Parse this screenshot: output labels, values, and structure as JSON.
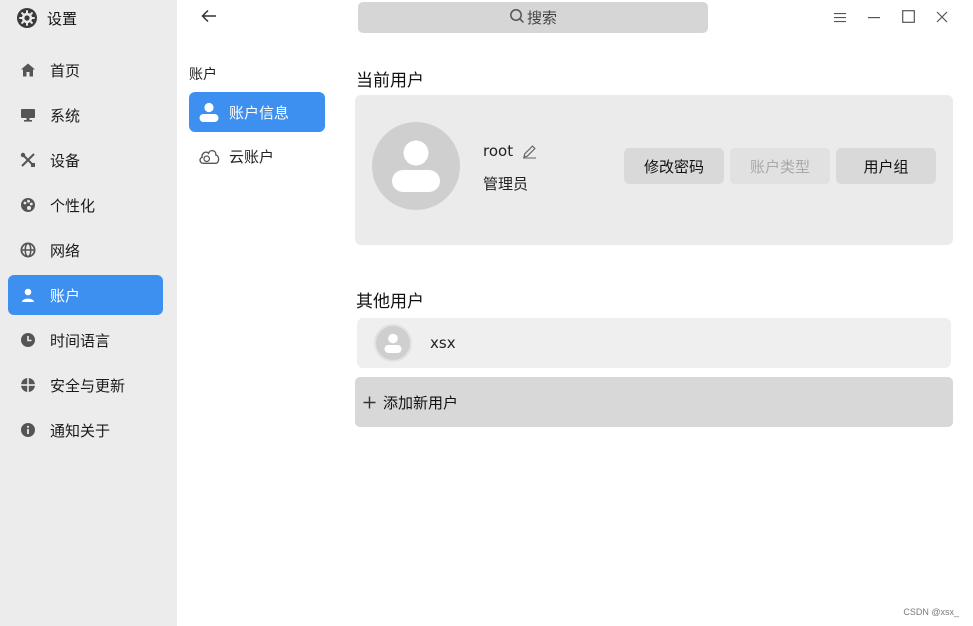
{
  "app": {
    "title": "设置",
    "icon": "gear-icon"
  },
  "sidebar": {
    "items": [
      {
        "label": "首页",
        "icon": "home-icon"
      },
      {
        "label": "系统",
        "icon": "monitor-icon"
      },
      {
        "label": "设备",
        "icon": "tools-icon"
      },
      {
        "label": "个性化",
        "icon": "palette-icon"
      },
      {
        "label": "网络",
        "icon": "globe-icon"
      },
      {
        "label": "账户",
        "icon": "user-icon",
        "active": true
      },
      {
        "label": "时间语言",
        "icon": "clock-icon"
      },
      {
        "label": "安全与更新",
        "icon": "shield-icon"
      },
      {
        "label": "通知关于",
        "icon": "info-icon"
      }
    ]
  },
  "subnav": {
    "heading": "账户",
    "items": [
      {
        "label": "账户信息",
        "icon": "user-icon",
        "active": true
      },
      {
        "label": "云账户",
        "icon": "cloud-icon"
      }
    ]
  },
  "search": {
    "label": "搜索"
  },
  "current_user": {
    "section_title": "当前用户",
    "name": "root",
    "role": "管理员",
    "buttons": {
      "change_password": "修改密码",
      "account_type": "账户类型",
      "user_group": "用户组"
    }
  },
  "other_users": {
    "section_title": "其他用户",
    "users": [
      {
        "name": "xsx"
      }
    ],
    "add_label": "添加新用户"
  },
  "watermark": "CSDN @xsx_",
  "colors": {
    "accent": "#3d8ff0",
    "sidebar_bg": "#ececec",
    "card_bg": "#ebebeb"
  }
}
